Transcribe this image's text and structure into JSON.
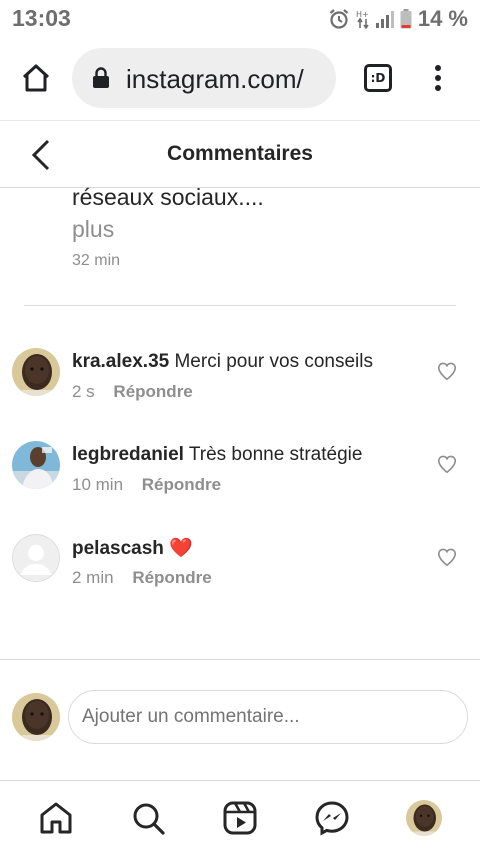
{
  "status_bar": {
    "time": "13:03",
    "battery_percent": "14 %",
    "icons": [
      "alarm-icon",
      "network-icon",
      "signal-icon",
      "battery-icon"
    ]
  },
  "browser": {
    "url": "instagram.com/",
    "tab_switcher_label": ":D",
    "icons": [
      "home-icon",
      "lock-icon",
      "tab-switcher-icon",
      "menu-dots-icon"
    ]
  },
  "header": {
    "title": "Commentaires",
    "back_icon": "chevron-left-icon"
  },
  "caption": {
    "text": "réseaux sociaux....",
    "more": "plus",
    "time": "32 min"
  },
  "comments": [
    {
      "username": "kra.alex.35",
      "text": "Merci pour vos conseils",
      "time": "2 s",
      "reply_label": "Répondre",
      "avatar": "child-avatar"
    },
    {
      "username": "legbredaniel",
      "text": "Très bonne stratégie",
      "time": "10 min",
      "reply_label": "Répondre",
      "avatar": "man-avatar"
    },
    {
      "username": "pelascash",
      "text": "❤️",
      "time": "2 min",
      "reply_label": "Répondre",
      "avatar": "default-avatar"
    }
  ],
  "add_comment": {
    "placeholder": "Ajouter un commentaire..."
  },
  "bottom_nav": {
    "items": [
      "home-icon",
      "search-icon",
      "reels-icon",
      "messenger-icon",
      "profile-avatar"
    ]
  },
  "colors": {
    "text": "#262626",
    "secondary_text": "#8e8e8e",
    "divider": "#dbdbdb",
    "heart_red": "#e0245e"
  }
}
